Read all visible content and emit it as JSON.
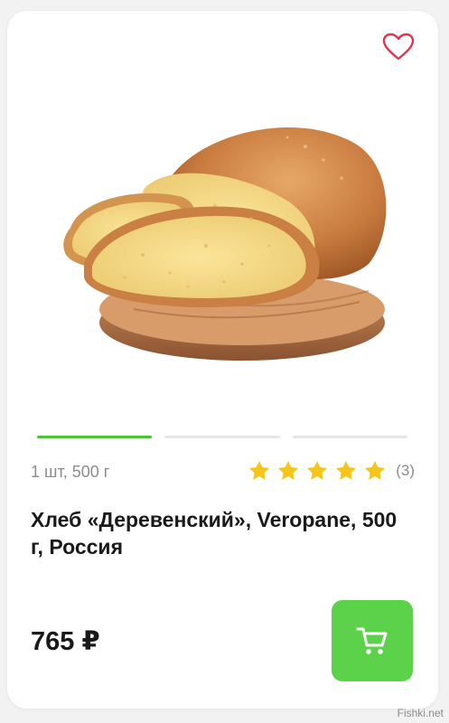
{
  "product": {
    "weight_label": "1 шт, 500 г",
    "title": "Хлеб «Деревенский», Veropane, 500 г, Россия",
    "price": "765 ₽",
    "rating_count": "(3)",
    "rating_stars": 5,
    "image_icon": "bread-loaf-on-board"
  },
  "carousel": {
    "slides": 3,
    "active_index": 0
  },
  "icons": {
    "favorite": "heart-outline-icon",
    "cart": "shopping-cart-icon",
    "star": "star-icon"
  },
  "colors": {
    "accent": "#5cd14a",
    "indicator_active": "#4fc23a",
    "star": "#f5c518",
    "heart": "#e0344f"
  },
  "watermark": "Fishki.net"
}
